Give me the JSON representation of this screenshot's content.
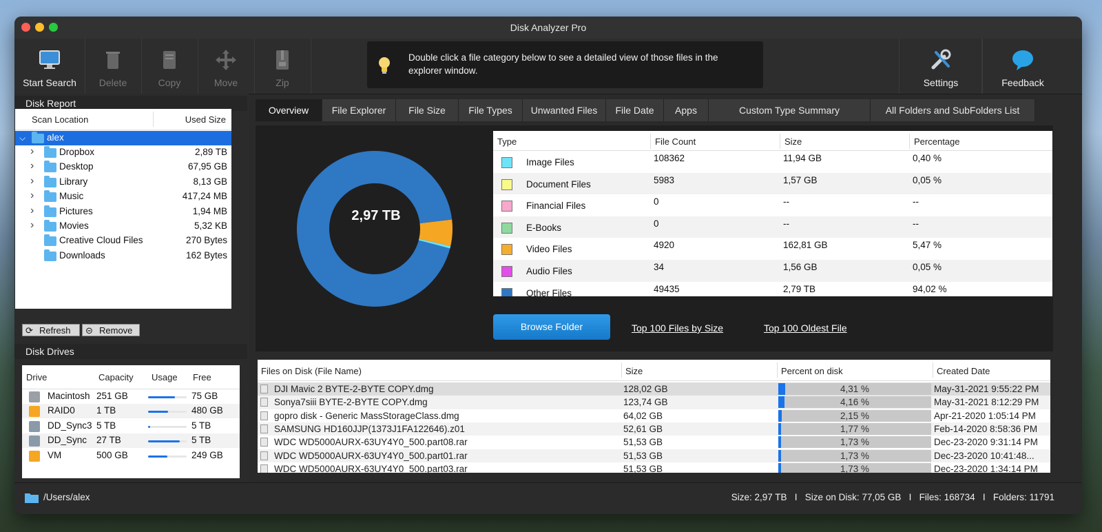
{
  "app": {
    "title": "Disk Analyzer Pro"
  },
  "toolbar": {
    "start_search": "Start Search",
    "delete": "Delete",
    "copy": "Copy",
    "move": "Move",
    "zip": "Zip",
    "settings": "Settings",
    "feedback": "Feedback",
    "hint": "Double click a file category below to see a detailed view of those files in the explorer window."
  },
  "disk_report": {
    "title": "Disk Report",
    "col_location": "Scan Location",
    "col_size": "Used Size",
    "root": "alex",
    "items": [
      {
        "name": "Dropbox",
        "size": "2,89 TB",
        "expandable": true
      },
      {
        "name": "Desktop",
        "size": "67,95 GB",
        "expandable": true
      },
      {
        "name": "Library",
        "size": "8,13 GB",
        "expandable": true
      },
      {
        "name": "Music",
        "size": "417,24 MB",
        "expandable": true
      },
      {
        "name": "Pictures",
        "size": "1,94 MB",
        "expandable": true
      },
      {
        "name": "Movies",
        "size": "5,32 KB",
        "expandable": true
      },
      {
        "name": "Creative Cloud Files",
        "size": "270 Bytes",
        "expandable": false
      },
      {
        "name": "Downloads",
        "size": "162 Bytes",
        "expandable": false
      }
    ],
    "refresh": "Refresh",
    "remove": "Remove"
  },
  "disk_drives": {
    "title": "Disk Drives",
    "cols": [
      "Drive",
      "Capacity",
      "Usage",
      "Free"
    ],
    "rows": [
      {
        "name": "Macintosh",
        "capacity": "251 GB",
        "usage": 0.7,
        "free": "75 GB",
        "color": "#9aa0a6"
      },
      {
        "name": "RAID0",
        "capacity": "1 TB",
        "usage": 0.52,
        "free": "480 GB",
        "color": "#f5a623"
      },
      {
        "name": "DD_Sync3",
        "capacity": "5 TB",
        "usage": 0.05,
        "free": "5 TB",
        "color": "#8a9aa8"
      },
      {
        "name": "DD_Sync",
        "capacity": "27 TB",
        "usage": 0.82,
        "free": "5 TB",
        "color": "#8a9aa8"
      },
      {
        "name": "VM",
        "capacity": "500 GB",
        "usage": 0.5,
        "free": "249 GB",
        "color": "#f5a623"
      }
    ]
  },
  "tabs": [
    "Overview",
    "File Explorer",
    "File Size",
    "File Types",
    "Unwanted Files",
    "File Date",
    "Apps",
    "Custom Type Summary",
    "All Folders and SubFolders List"
  ],
  "overview": {
    "total": "2,97 TB",
    "donut": {
      "other_pct": 94.02,
      "video_pct": 5.47,
      "rest_pct": 0.51,
      "color_other": "#2f78c4",
      "color_video": "#f5a623"
    },
    "cols": [
      "Type",
      "File Count",
      "Size",
      "Percentage"
    ],
    "rows": [
      {
        "type": "Image Files",
        "count": "108362",
        "size": "11,94 GB",
        "pct": "0,40 %",
        "color": "#6ee3f7"
      },
      {
        "type": "Document Files",
        "count": "5983",
        "size": "1,57 GB",
        "pct": "0,05 %",
        "color": "#fafa8a"
      },
      {
        "type": "Financial Files",
        "count": "0",
        "size": "--",
        "pct": "--",
        "color": "#f7a8cc"
      },
      {
        "type": "E-Books",
        "count": "0",
        "size": "--",
        "pct": "--",
        "color": "#8fd9a0"
      },
      {
        "type": "Video Files",
        "count": "4920",
        "size": "162,81 GB",
        "pct": "5,47 %",
        "color": "#f5ad30"
      },
      {
        "type": "Audio Files",
        "count": "34",
        "size": "1,56 GB",
        "pct": "0,05 %",
        "color": "#e24ee8"
      },
      {
        "type": "Other Files",
        "count": "49435",
        "size": "2,79 TB",
        "pct": "94,02 %",
        "color": "#2f78c4"
      }
    ],
    "browse": "Browse Folder",
    "link_top100_size": "Top 100 Files by Size",
    "link_top100_oldest": "Top 100 Oldest File"
  },
  "files": {
    "cols": [
      "Files on Disk (File Name)",
      "Size",
      "Percent on disk",
      "Created Date"
    ],
    "rows": [
      {
        "name": "DJI Mavic 2 BYTE-2-BYTE COPY.dmg",
        "size": "128,02 GB",
        "pct": "4,31 %",
        "pct_val": 0.0431,
        "date": "May-31-2021 9:55:22 PM"
      },
      {
        "name": "Sonya7siii BYTE-2-BYTE COPY.dmg",
        "size": "123,74 GB",
        "pct": "4,16 %",
        "pct_val": 0.0416,
        "date": "May-31-2021 8:12:29 PM"
      },
      {
        "name": "gopro disk - Generic MassStorageClass.dmg",
        "size": "64,02 GB",
        "pct": "2,15 %",
        "pct_val": 0.0215,
        "date": "Apr-21-2020 1:05:14 PM"
      },
      {
        "name": "SAMSUNG HD160JJP(1373J1FA122646).z01",
        "size": "52,61 GB",
        "pct": "1,77 %",
        "pct_val": 0.0177,
        "date": "Feb-14-2020 8:58:36 PM"
      },
      {
        "name": "WDC WD5000AURX-63UY4Y0_500.part08.rar",
        "size": "51,53 GB",
        "pct": "1,73 %",
        "pct_val": 0.0173,
        "date": "Dec-23-2020 9:31:14 PM"
      },
      {
        "name": "WDC WD5000AURX-63UY4Y0_500.part01.rar",
        "size": "51,53 GB",
        "pct": "1,73 %",
        "pct_val": 0.0173,
        "date": "Dec-23-2020 10:41:48..."
      },
      {
        "name": "WDC WD5000AURX-63UY4Y0_500.part03.rar",
        "size": "51,53 GB",
        "pct": "1,73 %",
        "pct_val": 0.0173,
        "date": "Dec-23-2020 1:34:14 PM"
      }
    ]
  },
  "status": {
    "path": "/Users/alex",
    "summary": "Size: 2,97 TB   I   Size on Disk: 77,05 GB   I   Files: 168734   I   Folders: 11791"
  }
}
